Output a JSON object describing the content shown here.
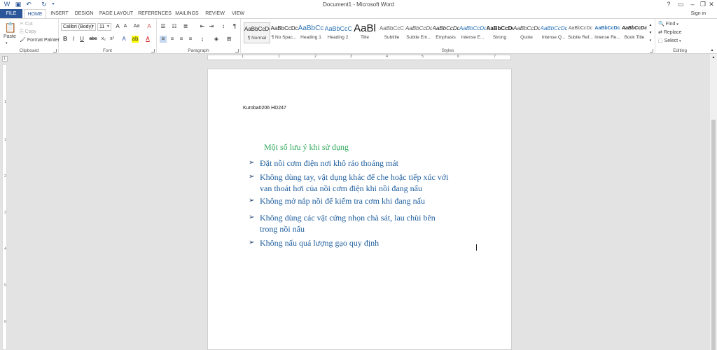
{
  "window": {
    "title": "Document1 - Microsoft Word",
    "help": "?",
    "signin": "Sign in"
  },
  "tabs": [
    "FILE",
    "HOME",
    "INSERT",
    "DESIGN",
    "PAGE LAYOUT",
    "REFERENCES",
    "MAILINGS",
    "REVIEW",
    "VIEW"
  ],
  "clipboard": {
    "label": "Clipboard",
    "paste": "Paste",
    "cut": "Cut",
    "copy": "Copy",
    "format_painter": "Format Painter"
  },
  "font": {
    "label": "Font",
    "family": "Calibri (Body)",
    "size": "11",
    "bold": "B",
    "italic": "I",
    "underline": "U",
    "strike": "abc",
    "subscript": "x₂",
    "superscript": "x²",
    "case": "Aa"
  },
  "paragraph": {
    "label": "Paragraph",
    "pilcrow": "¶"
  },
  "styles": {
    "label": "Styles",
    "items": [
      {
        "preview": "AaBbCcDc",
        "name": "¶ Normal"
      },
      {
        "preview": "AaBbCcDc",
        "name": "¶ No Spac..."
      },
      {
        "preview": "AaBbCc",
        "name": "Heading 1"
      },
      {
        "preview": "AaBbCcC",
        "name": "Heading 2"
      },
      {
        "preview": "AaBl",
        "name": "Title"
      },
      {
        "preview": "AaBbCcC",
        "name": "Subtitle"
      },
      {
        "preview": "AaBbCcDc",
        "name": "Subtle Em..."
      },
      {
        "preview": "AaBbCcDc",
        "name": "Emphasis"
      },
      {
        "preview": "AaBbCcDc",
        "name": "Intense E..."
      },
      {
        "preview": "AaBbCcDc",
        "name": "Strong"
      },
      {
        "preview": "AaBbCcDc",
        "name": "Quote"
      },
      {
        "preview": "AaBbCcDc",
        "name": "Intense Q..."
      },
      {
        "preview": "AaBbCcDc",
        "name": "Subtle Ref..."
      },
      {
        "preview": "AaBbCcDc",
        "name": "Intense Re..."
      },
      {
        "preview": "AaBbCcDc",
        "name": "Book Title"
      }
    ]
  },
  "editing": {
    "label": "Editing",
    "find": "Find",
    "replace": "Replace",
    "select": "Select"
  },
  "ruler": {
    "numbers": [
      "1",
      "1",
      "2",
      "3",
      "4",
      "5",
      "6",
      "7"
    ]
  },
  "vruler": {
    "numbers": [
      "1",
      "1",
      "2",
      "3",
      "4",
      "5",
      "6"
    ]
  },
  "document": {
    "header": "Kuroba0206 HD247",
    "heading": "Một số lưu ý khi sử dụng",
    "bullet_mark": "➢",
    "bullets": [
      [
        "Đặt nồi cơm điện nơi khô ráo thoáng mát"
      ],
      [
        "Không dùng tay, vật dụng khác để che  hoặc tiếp xúc với",
        "van thoát hơi của nồi cơm điện khi nồi đang nấu"
      ],
      [
        "Không mở nắp nồi để kiểm tra cơm khi đang nấu"
      ],
      [
        "Không dùng các vật cứng nhọn chà  sát,  lau chùi bên",
        "trong nồi nấu"
      ],
      [
        "Không nấu quá lượng gạo quy định"
      ]
    ]
  },
  "colors": {
    "accent": "#2b579a",
    "heading_green": "#2fa85a",
    "bullet_blue": "#1f5f9e"
  }
}
